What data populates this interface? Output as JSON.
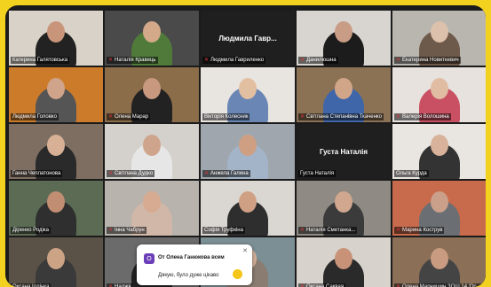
{
  "participants": [
    {
      "name": "Катерина Галятовська",
      "mic": "on",
      "bg": "#d9d2c8",
      "skin": "#c9957a",
      "cloth": "#222",
      "active": true
    },
    {
      "name": "Наталія Кравець",
      "mic": "muted",
      "bg": "#4a4a4a",
      "skin": "#d4a98a",
      "cloth": "#4f7a3a"
    },
    {
      "name": "Людмила Гавриленко",
      "mic": "muted",
      "placeholder": "Людмила  Гавр..."
    },
    {
      "name": "Данилюшна",
      "mic": "muted",
      "bg": "#d8d4cf",
      "skin": "#c99c85",
      "cloth": "#1c1c1c"
    },
    {
      "name": "Екатерина Новиткевич",
      "mic": "muted",
      "bg": "#b9b6b0",
      "skin": "#dcc1ac",
      "cloth": "#6e5a4a"
    },
    {
      "name": "Людмила Головко",
      "mic": "on",
      "bg": "#cc7b2b",
      "skin": "#cfa48a",
      "cloth": "#555"
    },
    {
      "name": "Олена Марар",
      "mic": "muted",
      "bg": "#8c6d4a",
      "skin": "#c8997e",
      "cloth": "#222"
    },
    {
      "name": "Вікторія Колесник",
      "mic": "on",
      "bg": "#e8e4df",
      "skin": "#e3bfa2",
      "cloth": "#6a86b5"
    },
    {
      "name": "Світлана Степанівна Ткаченко",
      "mic": "muted",
      "bg": "#8c7255",
      "skin": "#d1a688",
      "cloth": "#3f66a8"
    },
    {
      "name": "Валерія Волошина",
      "mic": "muted",
      "bg": "#e7e2dd",
      "skin": "#e0bca2",
      "cloth": "#c95063"
    },
    {
      "name": "Ганна Чеплатонова",
      "mic": "on",
      "bg": "#7d6e61",
      "skin": "#d7b096",
      "cloth": "#2a2a2a"
    },
    {
      "name": "Світлана Дудко",
      "mic": "muted",
      "bg": "#d4d1cc",
      "skin": "#cfa48c",
      "cloth": "#e6e6e6"
    },
    {
      "name": "Анжела Галина",
      "mic": "muted",
      "bg": "#9fa6ad",
      "skin": "#cf9f83",
      "cloth": "#a3b3c8"
    },
    {
      "name": "Густа Наталія",
      "mic": "on",
      "placeholder": "Густа Наталія"
    },
    {
      "name": "Ольга Курда",
      "mic": "on",
      "bg": "#e9e5e0",
      "skin": "#d8b29a",
      "cloth": "#333"
    },
    {
      "name": "Діренко Родіка",
      "mic": "on",
      "bg": "#5c6b54",
      "skin": "#c28e73",
      "cloth": "#2f2f2f"
    },
    {
      "name": "Інна Чабрун",
      "mic": "muted",
      "bg": "#b8b3ad",
      "skin": "#d6ab91",
      "cloth": "#d0b7a8"
    },
    {
      "name": "Софія Труфкіна",
      "mic": "on",
      "bg": "#dad6d1",
      "skin": "#cfa084",
      "cloth": "#2e2e2e"
    },
    {
      "name": "Наталія Сметанка...",
      "mic": "muted",
      "bg": "#8f8a83",
      "skin": "#d1a88f",
      "cloth": "#3b3b3b"
    },
    {
      "name": "Марина Кострув",
      "mic": "muted",
      "bg": "#c86a4c",
      "skin": "#caa08a",
      "cloth": "#6b6f73"
    },
    {
      "name": "Оксана Іллінка",
      "mic": "on",
      "bg": "#5a5247",
      "skin": "#cda386",
      "cloth": "#3a3a3a"
    },
    {
      "name": "Наджя",
      "mic": "muted",
      "bg": "#6b6b6b",
      "skin": "#c99b7f",
      "cloth": "#202020"
    },
    {
      "name": "",
      "mic": "none",
      "bg": "#7c8f95",
      "skin": "#d4b19b",
      "cloth": "#8a7c70"
    },
    {
      "name": "Оксана Саквая",
      "mic": "muted",
      "bg": "#d7d2cc",
      "skin": "#c89279",
      "cloth": "#2a2a2a"
    },
    {
      "name": "Олена Марчишин ЗОШ 14 'Ос...",
      "mic": "muted",
      "bg": "#8b6f57",
      "skin": "#c99b80",
      "cloth": "#444"
    }
  ],
  "chat": {
    "avatar_letter": "О",
    "from": "От Олена Ганюкова всем",
    "message": "Дякую, було дуже цікаво"
  }
}
